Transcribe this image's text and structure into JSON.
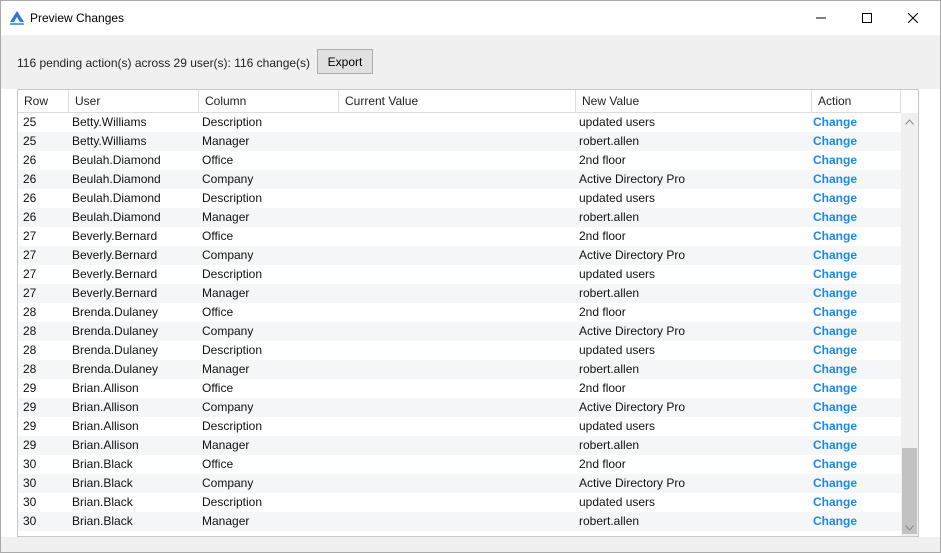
{
  "window": {
    "title": "Preview Changes"
  },
  "toolbar": {
    "summary": "116 pending action(s) across 29 user(s): 116 change(s)",
    "export_label": "Export"
  },
  "table": {
    "columns": [
      "Row",
      "User",
      "Column",
      "Current Value",
      "New Value",
      "Action"
    ],
    "rows": [
      {
        "row": "25",
        "user": "Betty.Williams",
        "column": "Description",
        "current": "",
        "new": "updated users",
        "action": "Change"
      },
      {
        "row": "25",
        "user": "Betty.Williams",
        "column": "Manager",
        "current": "",
        "new": "robert.allen",
        "action": "Change"
      },
      {
        "row": "26",
        "user": "Beulah.Diamond",
        "column": "Office",
        "current": "",
        "new": "2nd floor",
        "action": "Change"
      },
      {
        "row": "26",
        "user": "Beulah.Diamond",
        "column": "Company",
        "current": "",
        "new": "Active Directory Pro",
        "action": "Change"
      },
      {
        "row": "26",
        "user": "Beulah.Diamond",
        "column": "Description",
        "current": "",
        "new": "updated users",
        "action": "Change"
      },
      {
        "row": "26",
        "user": "Beulah.Diamond",
        "column": "Manager",
        "current": "",
        "new": "robert.allen",
        "action": "Change"
      },
      {
        "row": "27",
        "user": "Beverly.Bernard",
        "column": "Office",
        "current": "",
        "new": "2nd floor",
        "action": "Change"
      },
      {
        "row": "27",
        "user": "Beverly.Bernard",
        "column": "Company",
        "current": "",
        "new": "Active Directory Pro",
        "action": "Change"
      },
      {
        "row": "27",
        "user": "Beverly.Bernard",
        "column": "Description",
        "current": "",
        "new": "updated users",
        "action": "Change"
      },
      {
        "row": "27",
        "user": "Beverly.Bernard",
        "column": "Manager",
        "current": "",
        "new": "robert.allen",
        "action": "Change"
      },
      {
        "row": "28",
        "user": "Brenda.Dulaney",
        "column": "Office",
        "current": "",
        "new": "2nd floor",
        "action": "Change"
      },
      {
        "row": "28",
        "user": "Brenda.Dulaney",
        "column": "Company",
        "current": "",
        "new": "Active Directory Pro",
        "action": "Change"
      },
      {
        "row": "28",
        "user": "Brenda.Dulaney",
        "column": "Description",
        "current": "",
        "new": "updated users",
        "action": "Change"
      },
      {
        "row": "28",
        "user": "Brenda.Dulaney",
        "column": "Manager",
        "current": "",
        "new": "robert.allen",
        "action": "Change"
      },
      {
        "row": "29",
        "user": "Brian.Allison",
        "column": "Office",
        "current": "",
        "new": "2nd floor",
        "action": "Change"
      },
      {
        "row": "29",
        "user": "Brian.Allison",
        "column": "Company",
        "current": "",
        "new": "Active Directory Pro",
        "action": "Change"
      },
      {
        "row": "29",
        "user": "Brian.Allison",
        "column": "Description",
        "current": "",
        "new": "updated users",
        "action": "Change"
      },
      {
        "row": "29",
        "user": "Brian.Allison",
        "column": "Manager",
        "current": "",
        "new": "robert.allen",
        "action": "Change"
      },
      {
        "row": "30",
        "user": "Brian.Black",
        "column": "Office",
        "current": "",
        "new": "2nd floor",
        "action": "Change"
      },
      {
        "row": "30",
        "user": "Brian.Black",
        "column": "Company",
        "current": "",
        "new": "Active Directory Pro",
        "action": "Change"
      },
      {
        "row": "30",
        "user": "Brian.Black",
        "column": "Description",
        "current": "",
        "new": "updated users",
        "action": "Change"
      },
      {
        "row": "30",
        "user": "Brian.Black",
        "column": "Manager",
        "current": "",
        "new": "robert.allen",
        "action": "Change"
      }
    ]
  },
  "colors": {
    "action_link": "#1e88e5",
    "app_icon": "#2b7bd6"
  },
  "icons": {
    "app": "app-logo-icon",
    "minimize": "minimize-icon",
    "maximize": "maximize-icon",
    "close": "close-icon"
  }
}
